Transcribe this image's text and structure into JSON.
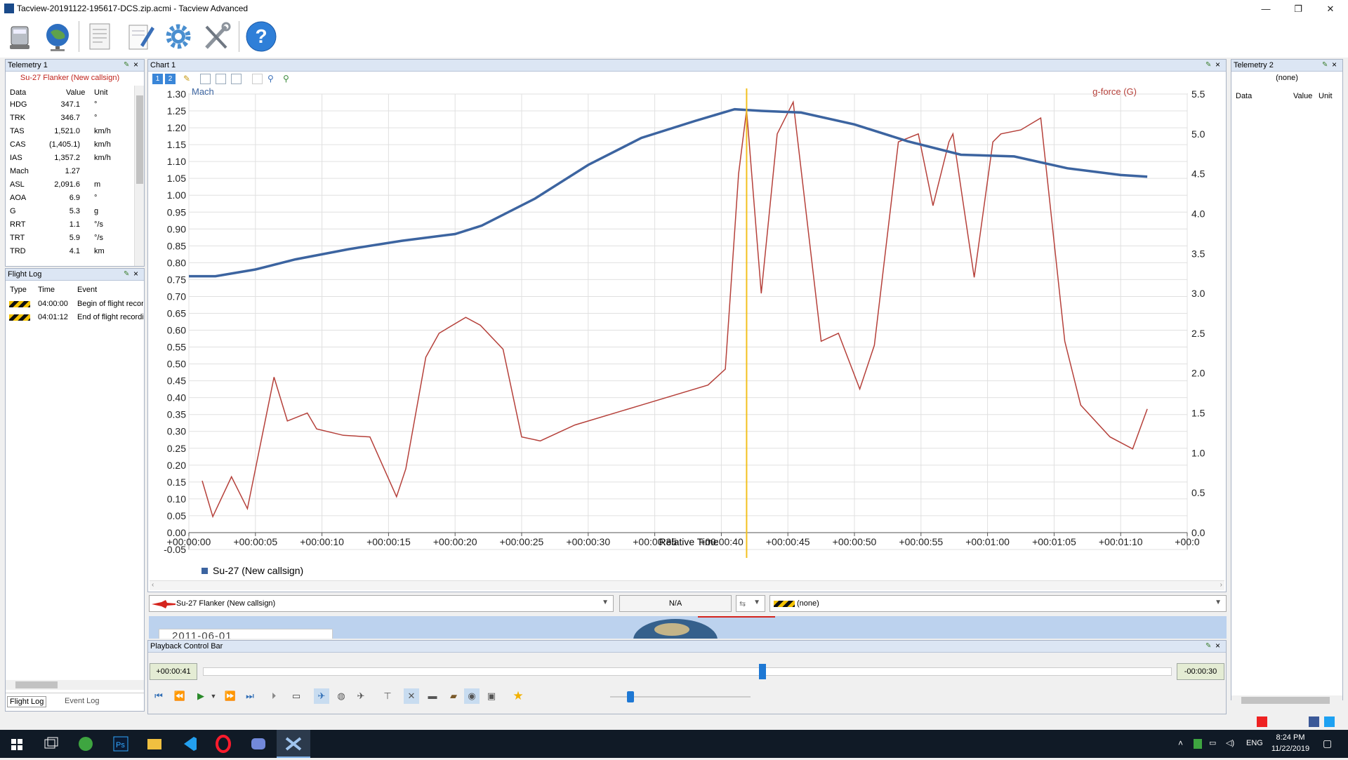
{
  "window": {
    "title": "Tacview-20191122-195617-DCS.zip.acmi - Tacview Advanced",
    "minimize": "—",
    "restore": "❐",
    "close": "✕"
  },
  "toolbar": {
    "buttons": [
      "tacview-server-icon",
      "globe-network-icon",
      "flight-log-document-icon",
      "notepad-edit-icon",
      "settings-gear-icon",
      "tools-wrench-icon",
      "help-question-icon"
    ],
    "help_glyph": "?"
  },
  "telemetry1": {
    "title": "Telemetry 1",
    "object": "Su-27 Flanker (New callsign)",
    "headers": {
      "data": "Data",
      "value": "Value",
      "unit": "Unit"
    },
    "rows": [
      {
        "name": "HDG",
        "value": "347.1",
        "unit": "°"
      },
      {
        "name": "TRK",
        "value": "346.7",
        "unit": "°"
      },
      {
        "name": "TAS",
        "value": "1,521.0",
        "unit": "km/h"
      },
      {
        "name": "CAS",
        "value": "(1,405.1)",
        "unit": "km/h"
      },
      {
        "name": "IAS",
        "value": "1,357.2",
        "unit": "km/h"
      },
      {
        "name": "Mach",
        "value": "1.27",
        "unit": ""
      },
      {
        "name": "ASL",
        "value": "2,091.6",
        "unit": "m"
      },
      {
        "name": "AOA",
        "value": "6.9",
        "unit": "°"
      },
      {
        "name": "G",
        "value": "5.3",
        "unit": "g"
      },
      {
        "name": "RRT",
        "value": "1.1",
        "unit": "°/s"
      },
      {
        "name": "TRT",
        "value": "5.9",
        "unit": "°/s"
      },
      {
        "name": "TRD",
        "value": "4.1",
        "unit": "km"
      }
    ]
  },
  "flightlog": {
    "title": "Flight Log",
    "headers": {
      "type": "Type",
      "time": "Time",
      "event": "Event"
    },
    "rows": [
      {
        "time": "04:00:00",
        "event": "Begin of flight recording"
      },
      {
        "time": "04:01:12",
        "event": "End of flight recording"
      }
    ],
    "tabs": [
      "Flight Log",
      "Event Log"
    ]
  },
  "telemetry2": {
    "title": "Telemetry 2",
    "object": "(none)",
    "headers": {
      "data": "Data",
      "value": "Value",
      "unit": "Unit"
    }
  },
  "chart_panel": {
    "title": "Chart 1",
    "tools": [
      "1",
      "2"
    ],
    "legend": "Su-27 (New callsign)"
  },
  "chart_data": {
    "type": "line",
    "xlabel": "Relative Time",
    "ylabel_left": "Mach",
    "ylabel_right": "g-force (G)",
    "x_ticks": [
      "+00:00:00",
      "+00:00:05",
      "+00:00:10",
      "+00:00:15",
      "+00:00:20",
      "+00:00:25",
      "+00:00:30",
      "+00:00:35",
      "+00:00:40",
      "+00:00:45",
      "+00:00:50",
      "+00:00:55",
      "+00:01:00",
      "+00:01:05",
      "+00:01:10",
      "+00:0"
    ],
    "x_range_seconds": [
      0,
      75
    ],
    "ylim_left": [
      -0.05,
      1.3
    ],
    "ylim_right": [
      0,
      5.5
    ],
    "left_ticks": [
      "1.30",
      "1.25",
      "1.20",
      "1.15",
      "1.10",
      "1.05",
      "1.00",
      "0.95",
      "0.90",
      "0.85",
      "0.80",
      "0.75",
      "0.70",
      "0.65",
      "0.60",
      "0.55",
      "0.50",
      "0.45",
      "0.40",
      "0.35",
      "0.30",
      "0.25",
      "0.20",
      "0.15",
      "0.10",
      "0.05",
      "0.00",
      "-0.05"
    ],
    "right_ticks": [
      "5.5",
      "5.0",
      "4.5",
      "4.0",
      "3.5",
      "3.0",
      "2.5",
      "2.0",
      "1.5",
      "1.0",
      "0.5",
      "0.0"
    ],
    "cursor_seconds": 41.9,
    "grid": true,
    "series": [
      {
        "name": "Mach",
        "color": "#3c64a0",
        "axis": "left",
        "x": [
          0,
          2,
          5,
          8,
          12,
          16,
          20,
          22,
          26,
          30,
          34,
          38,
          41,
          43,
          46,
          50,
          54,
          58,
          62,
          66,
          70,
          72
        ],
        "y": [
          0.76,
          0.76,
          0.78,
          0.81,
          0.84,
          0.865,
          0.885,
          0.91,
          0.99,
          1.09,
          1.17,
          1.22,
          1.255,
          1.25,
          1.245,
          1.21,
          1.16,
          1.12,
          1.115,
          1.08,
          1.06,
          1.055
        ]
      },
      {
        "name": "g-force (G)",
        "color": "#b5403a",
        "axis": "right",
        "x": [
          1.0,
          1.8,
          3.2,
          4.4,
          6.4,
          7.4,
          8.9,
          9.6,
          11.6,
          13.6,
          15.6,
          16.3,
          17.8,
          18.8,
          20.8,
          21.9,
          23.6,
          25.0,
          26.4,
          29.0,
          34.0,
          39.0,
          40.3,
          41.3,
          41.9,
          43.0,
          44.2,
          45.4,
          47.5,
          48.8,
          50.4,
          51.5,
          53.3,
          54.8,
          55.9,
          57.1,
          57.4,
          59.0,
          60.4,
          61.0,
          62.5,
          64.0,
          65.8,
          67.0,
          69.2,
          70.9,
          72.0
        ],
        "y": [
          0.65,
          0.2,
          0.7,
          0.3,
          1.95,
          1.4,
          1.5,
          1.3,
          1.22,
          1.2,
          0.45,
          0.8,
          2.2,
          2.5,
          2.7,
          2.6,
          2.3,
          1.2,
          1.15,
          1.35,
          1.6,
          1.85,
          2.05,
          4.5,
          5.3,
          3.0,
          5.0,
          5.4,
          2.4,
          2.5,
          1.8,
          2.35,
          4.9,
          5.0,
          4.1,
          4.9,
          5.0,
          3.2,
          4.9,
          5.0,
          5.05,
          5.2,
          2.4,
          1.6,
          1.2,
          1.05,
          1.55
        ]
      }
    ]
  },
  "selector": {
    "object": "Su-27 Flanker (New callsign)",
    "distance": "N/A",
    "target": "(none)"
  },
  "playback": {
    "title": "Playback Control Bar",
    "elapsed": "+00:00:41",
    "remaining": "-00:00:30",
    "map_date": "2011-06-01",
    "progress": 0.577,
    "speed_level": 0.04
  },
  "taskbar": {
    "lang": "ENG",
    "time": "8:24 PM",
    "date": "11/22/2019"
  }
}
